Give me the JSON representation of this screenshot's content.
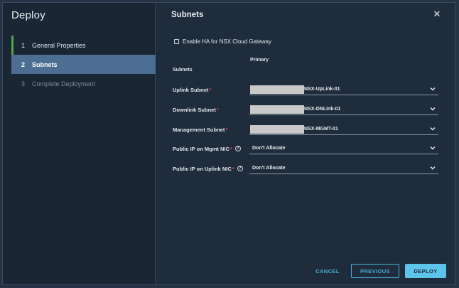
{
  "wizard": {
    "title": "Deploy",
    "steps": [
      {
        "num": "1",
        "label": "General Properties"
      },
      {
        "num": "2",
        "label": "Subnets"
      },
      {
        "num": "3",
        "label": "Complete Deployment"
      }
    ]
  },
  "content": {
    "title": "Subnets",
    "ha_checkbox_label": "Enable HA for NSX Cloud Gateway",
    "col_primary": "Primary",
    "col_subnets": "Subnets",
    "fields": [
      {
        "label": "Uplink Subnet",
        "value": "NSX-UpLink-01"
      },
      {
        "label": "Downlink Subnet",
        "value": "NSX-DNLink-01"
      },
      {
        "label": "Management Subnet",
        "value": "NSX-MGMT-01"
      },
      {
        "label": "Public IP on Mgmt NIC",
        "value": "Don't Allocate"
      },
      {
        "label": "Public IP on Uplink NIC",
        "value": "Don't Allocate"
      }
    ],
    "required_mark": "*",
    "help_glyph": "?"
  },
  "footer": {
    "cancel": "CANCEL",
    "previous": "PREVIOUS",
    "deploy": "DEPLOY"
  },
  "close_glyph": "✕"
}
